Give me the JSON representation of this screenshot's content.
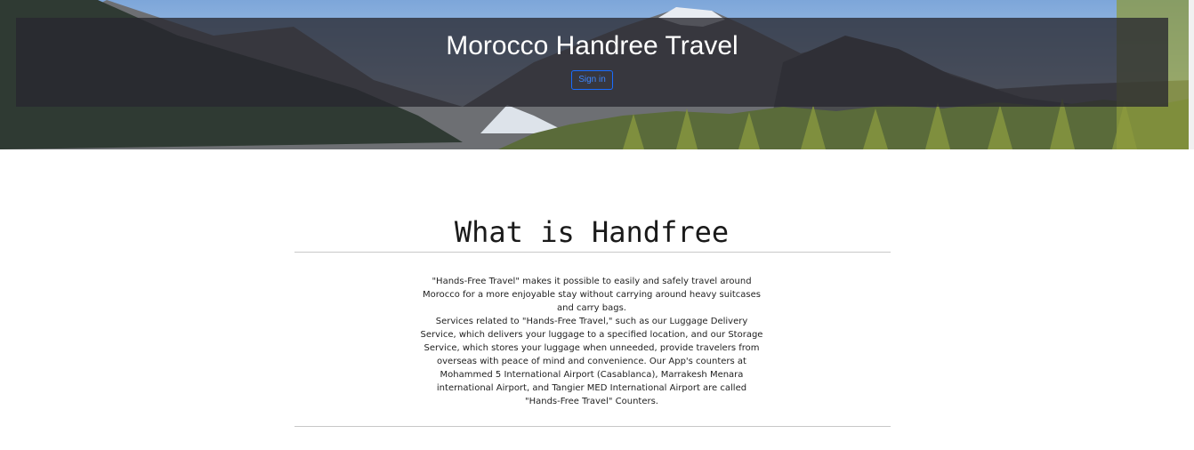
{
  "header": {
    "title": "Morocco Handree Travel",
    "signin_label": "Sign in",
    "signin_color": "#1a6cff",
    "background": "mountain-landscape-banner"
  },
  "about": {
    "heading": "What is Handfree",
    "paragraph_1": "\"Hands-Free Travel\" makes it possible to easily and safely travel around Morocco for a more enjoyable stay without carrying around heavy suitcases and carry bags.",
    "paragraph_2": "Services related to \"Hands-Free Travel,\" such as our Luggage Delivery Service, which delivers your luggage to a specified location, and our Storage Service, which stores your luggage when unneeded, provide travelers from overseas with peace of mind and convenience. Our App's counters at Mohammed 5 International Airport (Casablanca), Marrakesh Menara international Airport, and Tangier MED International Airport are called \"Hands-Free Travel\" Counters."
  }
}
